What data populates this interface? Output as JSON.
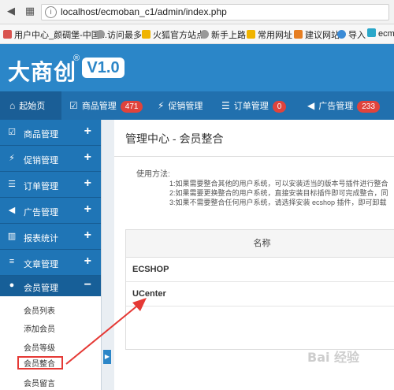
{
  "browser": {
    "url": "localhost/ecmoban_c1/admin/index.php",
    "bookmarks": [
      {
        "label": "用户中心_颜碉堡-中国...",
        "icon": "user-center-icon",
        "color": "#d9534f"
      },
      {
        "label": "访问最多",
        "icon": "gear-icon",
        "color": "#888888"
      },
      {
        "label": "火狐官方站点",
        "icon": "folder-icon",
        "color": "#f0b400"
      },
      {
        "label": "新手上路",
        "icon": "gear-icon",
        "color": "#888888"
      },
      {
        "label": "常用网址",
        "icon": "folder-icon",
        "color": "#f0b400"
      },
      {
        "label": "建议网站",
        "icon": "bing-icon",
        "color": "#e67e22"
      },
      {
        "label": "导入",
        "icon": "globe-icon",
        "color": "#3b8bd6"
      },
      {
        "label": "ecm",
        "icon": "sc-icon",
        "color": "#2aa7c9"
      }
    ]
  },
  "header": {
    "logo": "大商创",
    "reg": "®",
    "version": "V1.0"
  },
  "topnav": [
    {
      "label": "起始页",
      "icon": "home-icon",
      "glyph": "⌂"
    },
    {
      "label": "商品管理",
      "icon": "check-icon",
      "glyph": "☑",
      "badge": "471"
    },
    {
      "label": "促销管理",
      "icon": "bolt-icon",
      "glyph": "⚡"
    },
    {
      "label": "订单管理",
      "icon": "list-icon",
      "glyph": "☰",
      "badge": "0"
    },
    {
      "label": "广告管理",
      "icon": "speaker-icon",
      "glyph": "◀"
    },
    {
      "badge": "233"
    }
  ],
  "sidebar": {
    "items": [
      {
        "label": "商品管理",
        "icon": "check-icon",
        "glyph": "☑",
        "toggle": "+"
      },
      {
        "label": "促销管理",
        "icon": "bolt-icon",
        "glyph": "⚡",
        "toggle": "+"
      },
      {
        "label": "订单管理",
        "icon": "list-icon",
        "glyph": "☰",
        "toggle": "+"
      },
      {
        "label": "广告管理",
        "icon": "speaker-icon",
        "glyph": "◀",
        "toggle": "+"
      },
      {
        "label": "报表统计",
        "icon": "chart-icon",
        "glyph": "▥",
        "toggle": "+"
      },
      {
        "label": "文章管理",
        "icon": "article-icon",
        "glyph": "≡",
        "toggle": "+"
      },
      {
        "label": "会员管理",
        "icon": "user-icon",
        "glyph": "●",
        "toggle": "−"
      }
    ],
    "subitems": [
      "会员列表",
      "添加会员",
      "会员等级",
      "会员整合",
      "会员留言"
    ],
    "current_subitem": "会员整合"
  },
  "main": {
    "title": "管理中心 - 会员整合",
    "usage_label": "使用方法:",
    "usage_lines": [
      "1:如果需要整合其他的用户系统，可以安装适当的版本号插件进行整合",
      "2:如果需要更换整合的用户系统，直接安装目标插件即可完成整合，同",
      "3:如果不需要整合任何用户系统，请选择安装 ecshop 插件，即可卸载"
    ],
    "table": {
      "header": "名称",
      "rows": [
        "ECSHOP",
        "UCenter"
      ]
    }
  },
  "watermark": "Bai 经验",
  "colors": {
    "brand": "#2b86c8",
    "nav": "#2170ae",
    "badge": "#e0433c",
    "highlight": "#e53935"
  }
}
